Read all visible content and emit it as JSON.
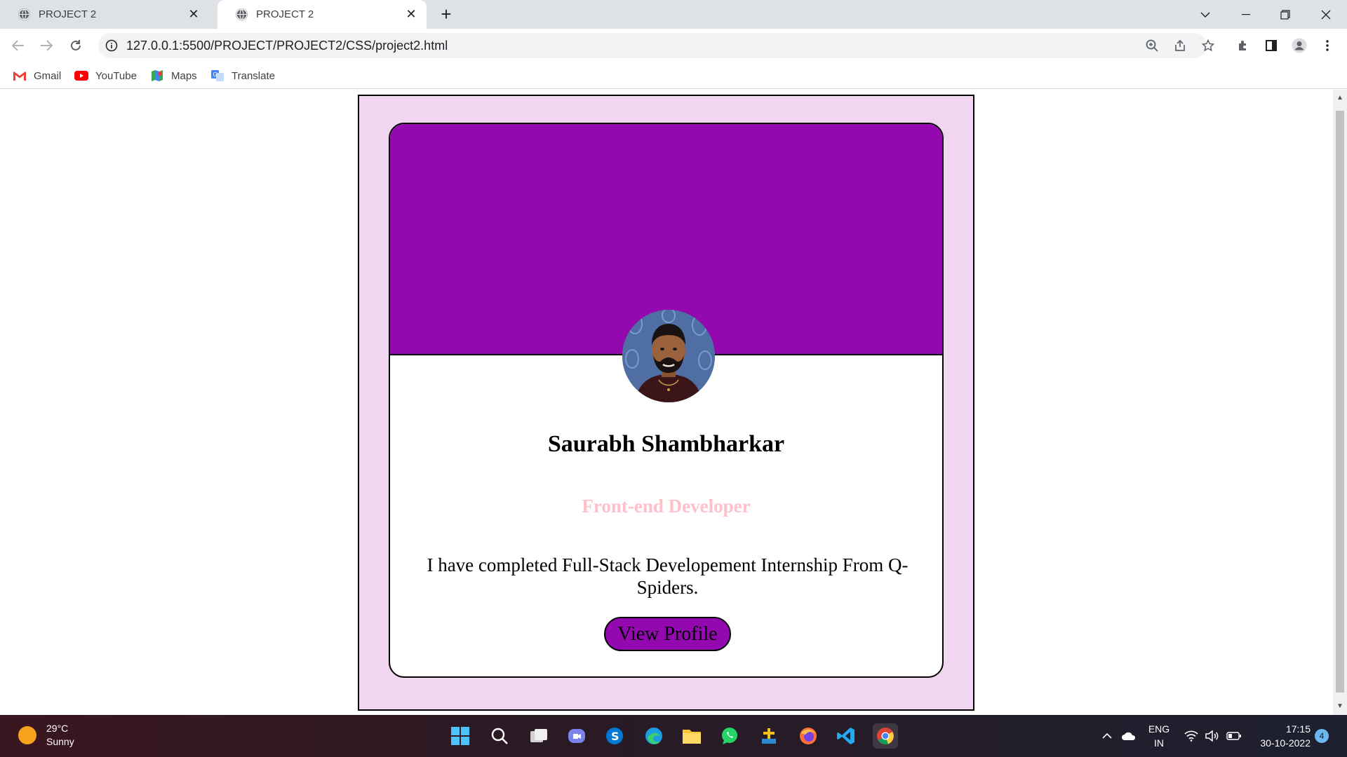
{
  "browser": {
    "tabs": [
      {
        "title": "PROJECT 2",
        "active": false
      },
      {
        "title": "PROJECT 2",
        "active": true
      }
    ],
    "url": "127.0.0.1:5500/PROJECT/PROJECT2/CSS/project2.html",
    "bookmarks": [
      {
        "label": "Gmail",
        "icon": "gmail-icon"
      },
      {
        "label": "YouTube",
        "icon": "youtube-icon"
      },
      {
        "label": "Maps",
        "icon": "maps-icon"
      },
      {
        "label": "Translate",
        "icon": "translate-icon"
      }
    ]
  },
  "page": {
    "name": "Saurabh Shambharkar",
    "role": "Front-end Developer",
    "description": "I have completed Full-Stack Developement Internship From Q-Spiders.",
    "button_label": "View Profile",
    "colors": {
      "outer_bg": "#f0d6f0",
      "banner": "#9309af",
      "role_text": "#ffc0cb",
      "button_bg": "#9309af"
    }
  },
  "taskbar": {
    "weather": {
      "temp": "29°C",
      "condition": "Sunny"
    },
    "apps": [
      "windows-start-icon",
      "search-icon",
      "task-view-icon",
      "teams-chat-icon",
      "skype-icon",
      "edge-icon",
      "file-explorer-icon",
      "whatsapp-icon",
      "app-icon",
      "firefox-icon",
      "vscode-icon",
      "chrome-icon"
    ],
    "language": {
      "line1": "ENG",
      "line2": "IN"
    },
    "time": "17:15",
    "date": "30-10-2022",
    "notifications": "4"
  }
}
